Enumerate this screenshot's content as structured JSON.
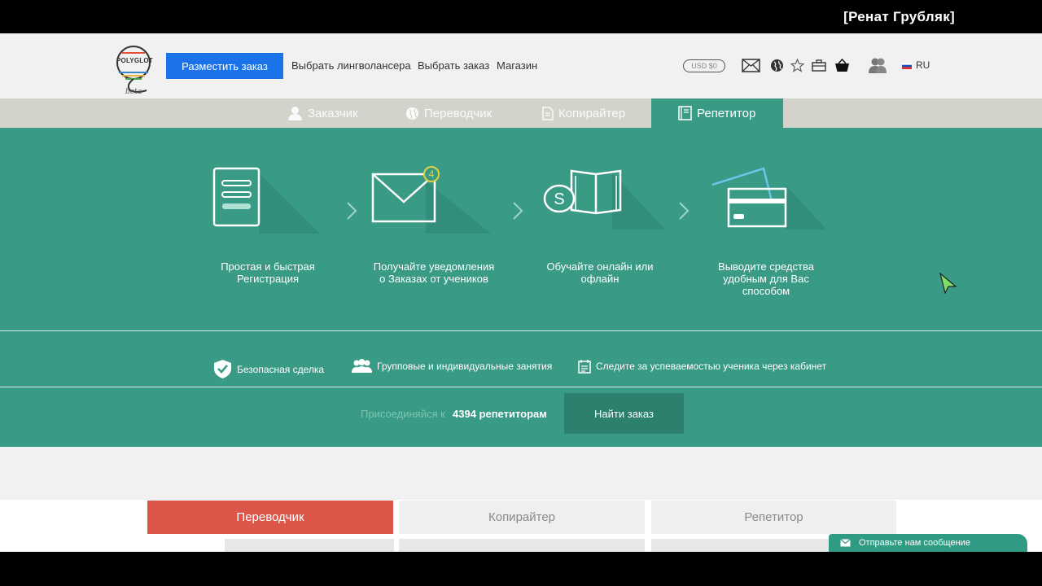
{
  "caption": "[Ренат Грубляк]",
  "header": {
    "logo_text": "POLYGLOT",
    "logo_beta": "beta",
    "order_button": "Разместить заказ",
    "nav": [
      "Выбрать лингволансера",
      "Выбрать заказ",
      "Магазин"
    ],
    "balance": "USD $0",
    "language": "RU",
    "icons": [
      "mail-icon",
      "globe-icon",
      "star-icon",
      "briefcase-icon",
      "basket-icon",
      "users-icon",
      "flag-ru-icon"
    ]
  },
  "tabs": [
    {
      "label": "Заказчик",
      "icon": "person-icon",
      "active": false
    },
    {
      "label": "Переводчик",
      "icon": "globe-icon",
      "active": false
    },
    {
      "label": "Копирайтер",
      "icon": "document-icon",
      "active": false
    },
    {
      "label": "Репетитор",
      "icon": "book-icon",
      "active": true
    }
  ],
  "steps": [
    {
      "label_line1": "Простая и быстрая",
      "label_line2": "Регистрация",
      "label_line3": "",
      "icon": "form-icon"
    },
    {
      "label_line1": "Получайте уведомления",
      "label_line2": "о Заказах от учеников",
      "label_line3": "",
      "icon": "envelope-icon",
      "badge": "4"
    },
    {
      "label_line1": "Обучайте онлайн или",
      "label_line2": "офлайн",
      "label_line3": "",
      "icon": "skype-book-icon"
    },
    {
      "label_line1": "Выводите средства",
      "label_line2": "удобным для Вас",
      "label_line3": "способом",
      "icon": "credit-card-icon"
    }
  ],
  "features": [
    {
      "label": "Безопасная сделка",
      "icon": "shield-check-icon"
    },
    {
      "label": "Групповые и индивидуальные занятия",
      "icon": "group-icon"
    },
    {
      "label": "Следите за успеваемостью ученика через кабинет",
      "icon": "calendar-icon"
    }
  ],
  "join": {
    "prefix": "Присоединяйся к",
    "count": "4394 репетиторам",
    "button": "Найти заказ"
  },
  "lower_tabs": [
    "Переводчик",
    "Копирайтер",
    "Репетитор"
  ],
  "chat": {
    "label": "Отправьте нам сообщение",
    "icon": "envelope-icon"
  },
  "colors": {
    "accent": "#399a86",
    "primary_button": "#1a73e8",
    "red_tab": "#dc574a",
    "dark_teal": "#2d7f6e"
  }
}
